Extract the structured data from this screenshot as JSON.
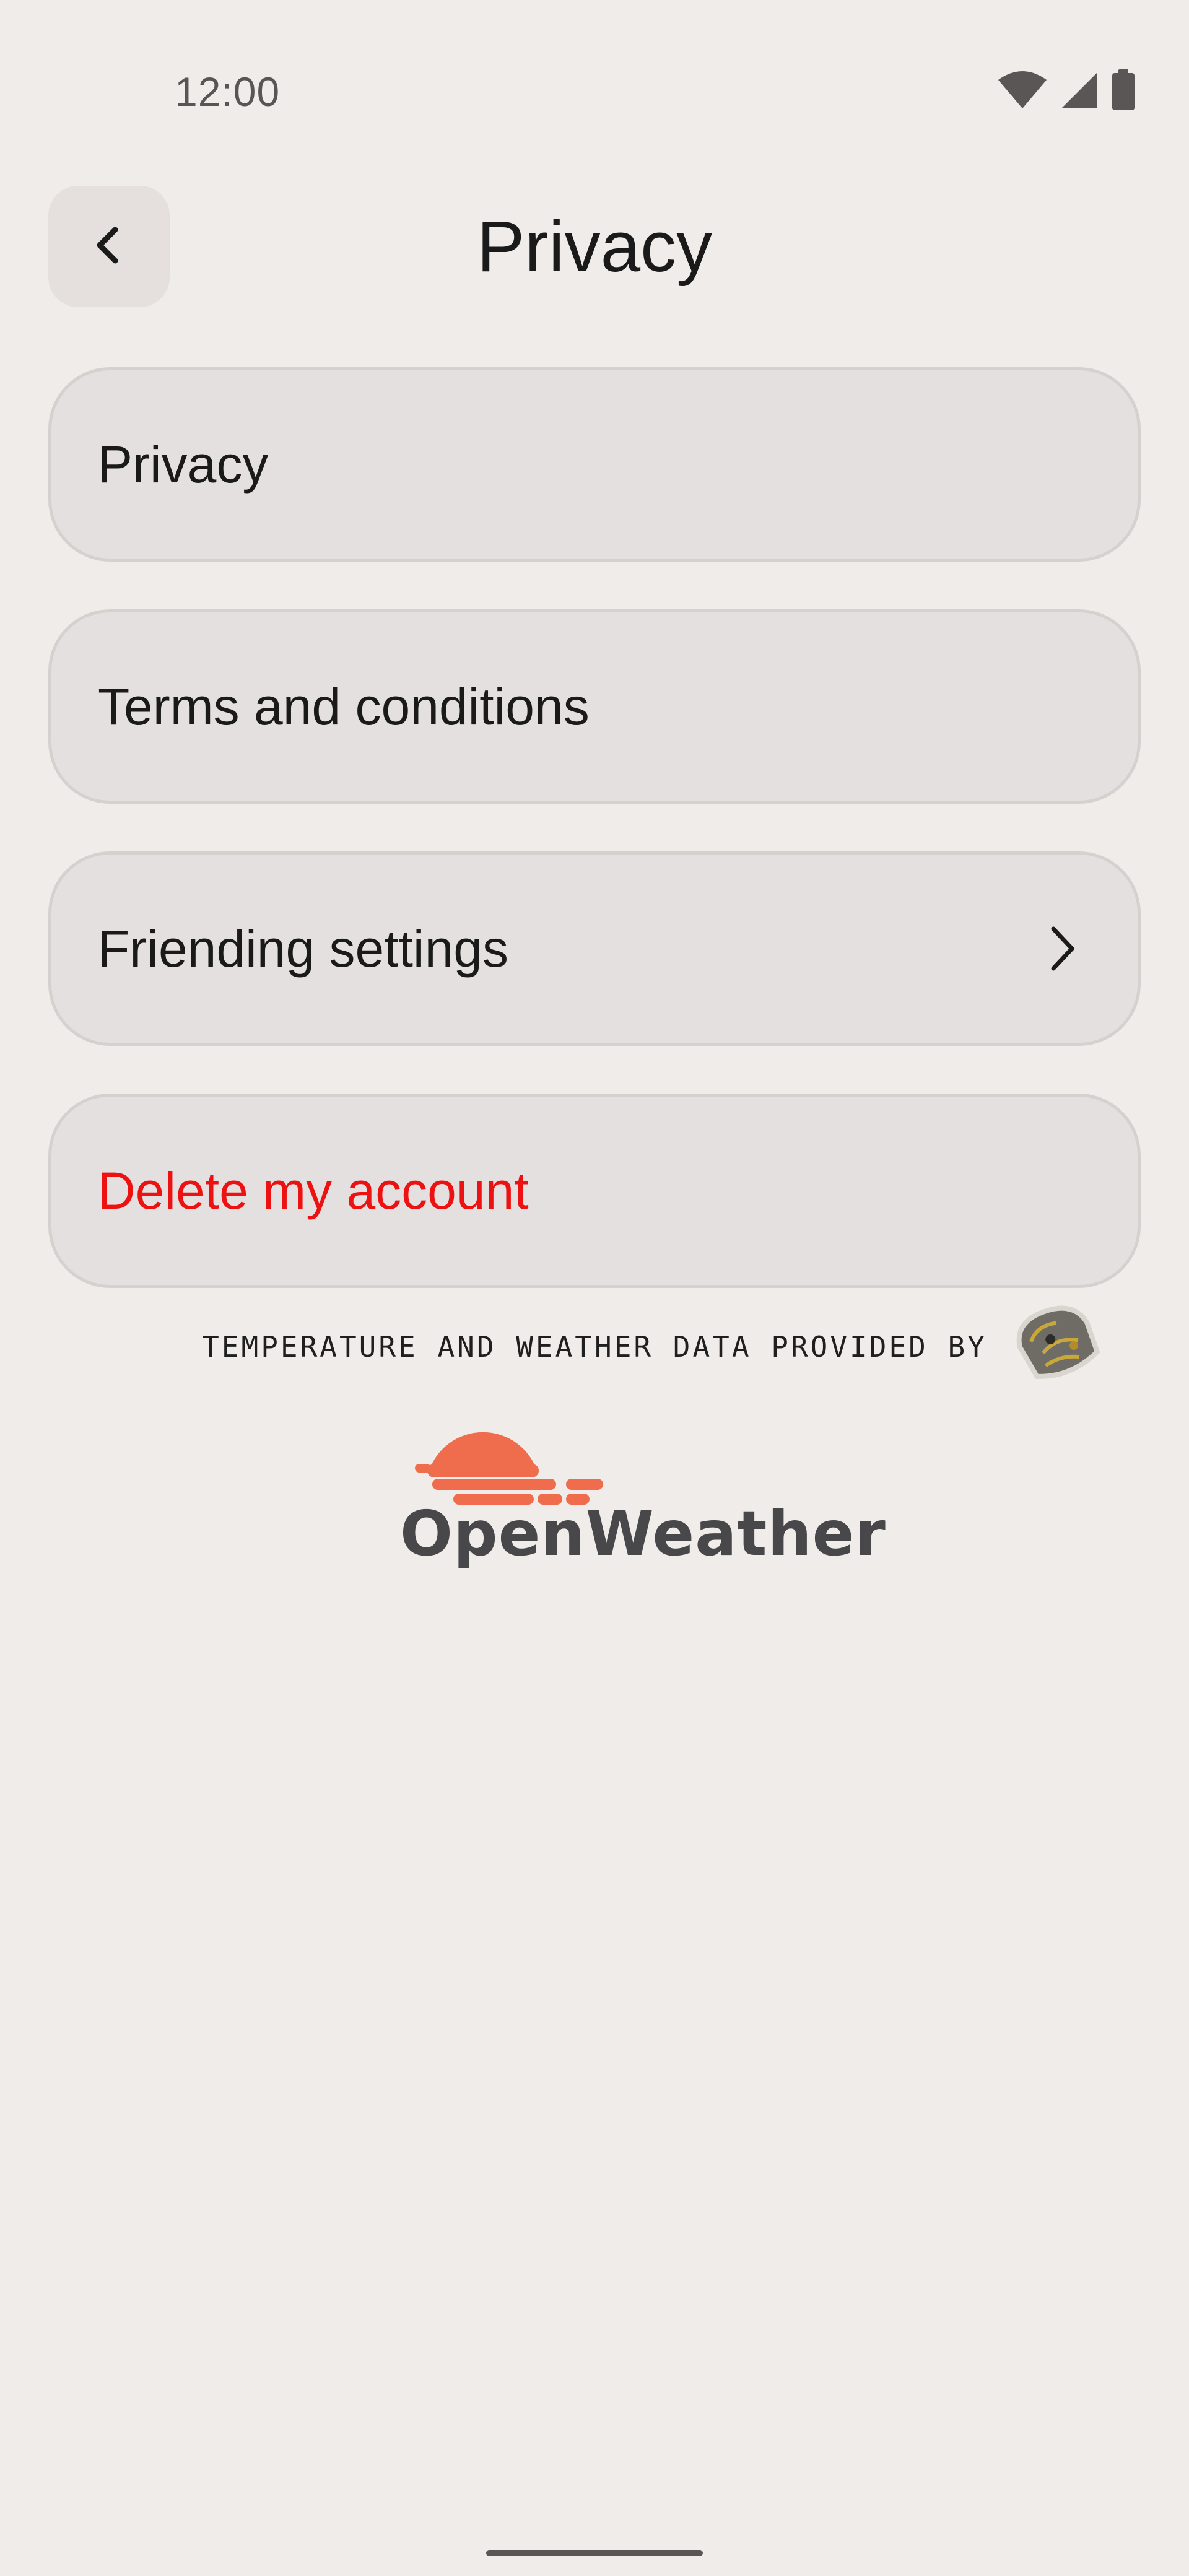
{
  "status_bar": {
    "time": "12:00",
    "icons": [
      "wifi-icon",
      "cell-signal-icon",
      "battery-icon"
    ]
  },
  "header": {
    "title": "Privacy",
    "back_icon": "chevron-left-icon"
  },
  "menu": {
    "items": [
      {
        "label": "Privacy"
      },
      {
        "label": "Terms and conditions"
      },
      {
        "label": "Friending settings",
        "trailing_icon": "chevron-right-icon"
      },
      {
        "label": "Delete my account",
        "style": "danger"
      }
    ]
  },
  "attribution": {
    "text": "TEMPERATURE AND WEATHER DATA PROVIDED BY",
    "brand": "OpenWeather",
    "brand_color": "#ef6c4d"
  },
  "colors": {
    "background": "#f0ecea",
    "card": "#e5e0e0",
    "danger": "#ee1111",
    "text": "#1a1a1a"
  }
}
